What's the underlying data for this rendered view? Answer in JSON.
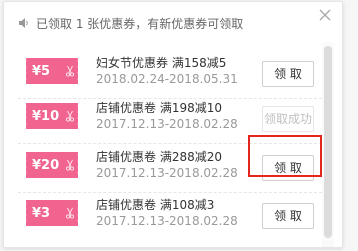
{
  "header": {
    "text": "已领取 1 张优惠券，有新优惠券可领取"
  },
  "coupons": [
    {
      "amount": "¥5",
      "title": "妇女节优惠券 满158减5",
      "dates": "2018.02.24-2018.05.31",
      "action": "领 取",
      "claimed": false
    },
    {
      "amount": "¥10",
      "title": "店铺优惠卷 满198减10",
      "dates": "2017.12.13-2018.02.28",
      "action": "领取成功",
      "claimed": true
    },
    {
      "amount": "¥20",
      "title": "店铺优惠卷 满288减20",
      "dates": "2017.12.13-2018.02.28",
      "action": "领 取",
      "claimed": false
    },
    {
      "amount": "¥3",
      "title": "店铺优惠卷 满108减3",
      "dates": "2017.12.13-2018.02.28",
      "action": "领 取",
      "claimed": false
    }
  ],
  "colors": {
    "coupon_tag": "#f0648f",
    "highlight": "#e3261b"
  }
}
